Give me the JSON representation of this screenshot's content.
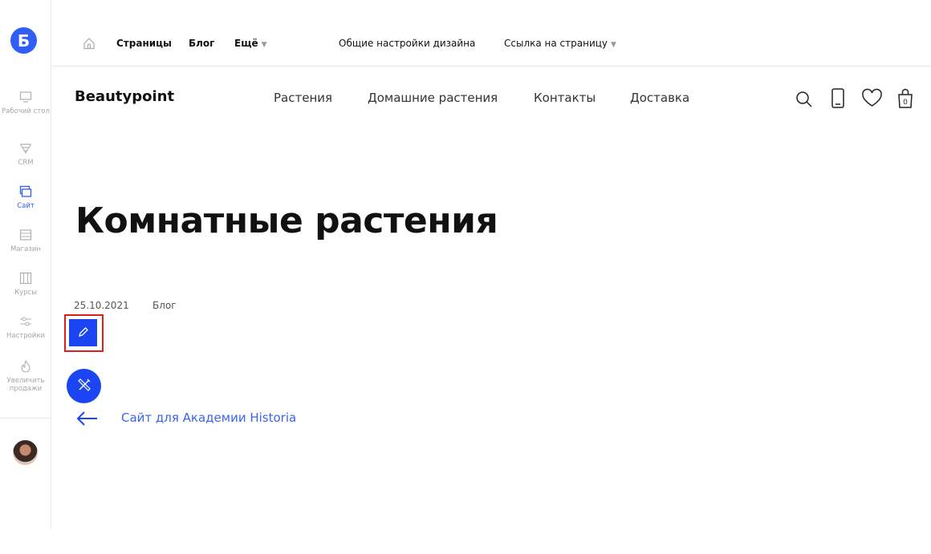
{
  "sidebar": {
    "logo": "Б",
    "items": [
      {
        "label": "Рабочий стол",
        "icon": "monitor-icon"
      },
      {
        "label": "CRM",
        "icon": "funnel-icon"
      },
      {
        "label": "Сайт",
        "icon": "site-icon"
      },
      {
        "label": "Магазин",
        "icon": "store-icon"
      },
      {
        "label": "Курсы",
        "icon": "courses-icon"
      },
      {
        "label": "Настройки",
        "icon": "sliders-icon"
      },
      {
        "label": "Увеличить продажи",
        "icon": "fire-icon"
      }
    ],
    "active": "Сайт"
  },
  "topbar": {
    "pages": "Страницы",
    "blog": "Блог",
    "more": "Ещё",
    "design_settings": "Общие настройки дизайна",
    "page_link": "Ссылка на страницу"
  },
  "site_header": {
    "brand": "Beautypoint",
    "nav": [
      "Растения",
      "Домашние растения",
      "Контакты",
      "Доставка"
    ],
    "cart_count": "0"
  },
  "content": {
    "title": "Комнатные растения",
    "date": "25.10.2021",
    "category": "Блог",
    "back_link": "Сайт для Академии Historia"
  },
  "colors": {
    "accent": "#1b45f2",
    "highlight_frame": "#d91f1f"
  }
}
